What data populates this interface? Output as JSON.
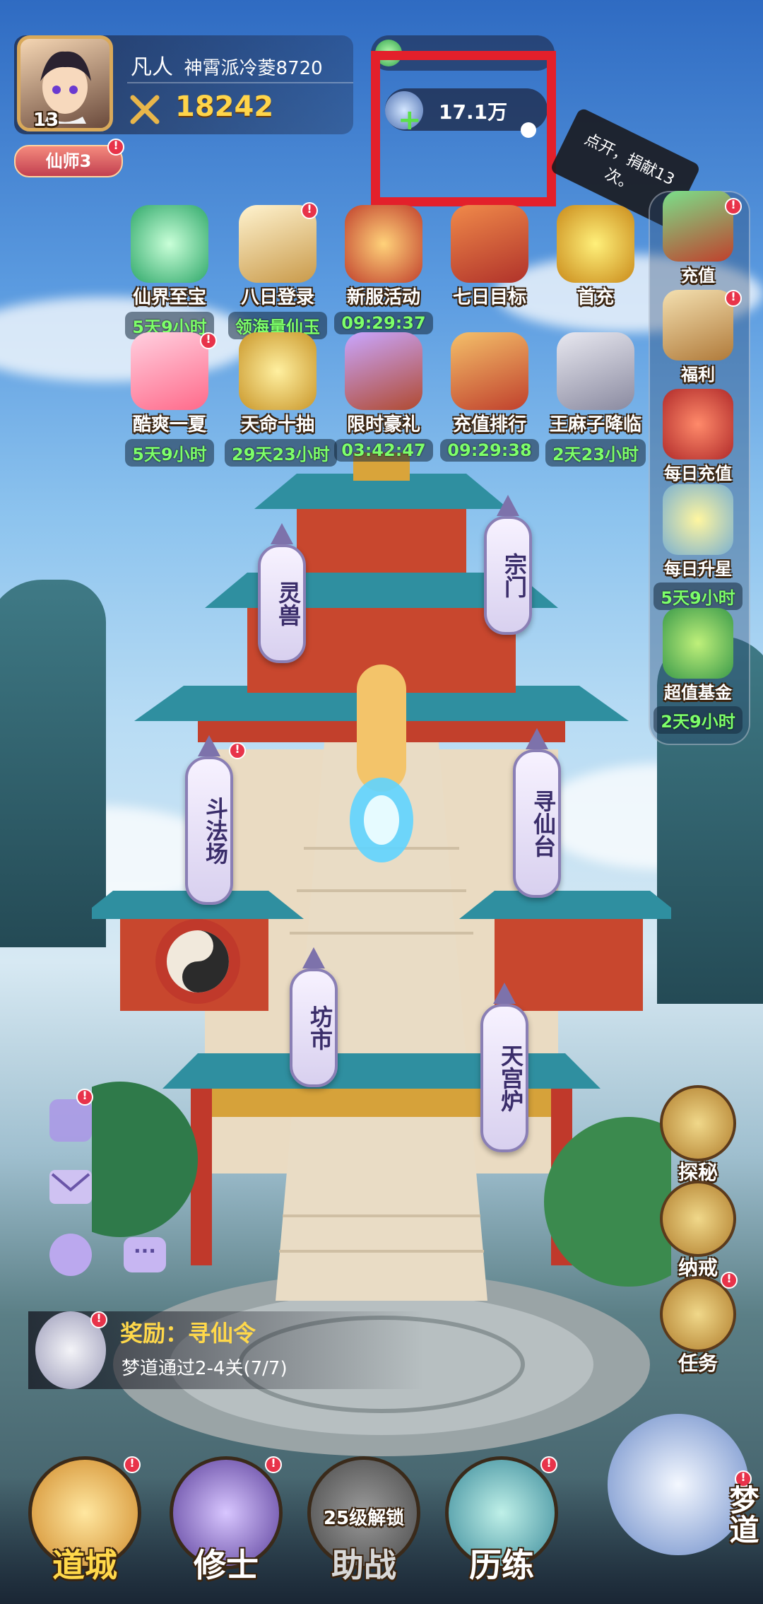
{
  "player": {
    "level": "13",
    "realm": "凡人",
    "name": "神霄派冷菱8720",
    "power": "18242",
    "title_badge": "仙师3"
  },
  "currency": {
    "top_value": "",
    "donate_value": "17.1万"
  },
  "tooltip": {
    "text": "点开，捐献13次。"
  },
  "events_row1": [
    {
      "label": "仙界至宝",
      "timer": "5天9小时",
      "icon": "jade-treasure-icon"
    },
    {
      "label": "八日登录",
      "timer": "领海量仙玉",
      "icon": "scroll-icon"
    },
    {
      "label": "新服活动",
      "timer": "09:29:37",
      "icon": "dragon-emblem-icon"
    },
    {
      "label": "七日目标",
      "timer": "",
      "icon": "chest-seven-icon"
    },
    {
      "label": "首充",
      "timer": "",
      "icon": "gold-coins-icon"
    }
  ],
  "events_row2": [
    {
      "label": "酷爽一夏",
      "timer": "5天9小时",
      "icon": "summer-drink-icon"
    },
    {
      "label": "天命十抽",
      "timer": "29天23小时",
      "icon": "fortune-bag-icon"
    },
    {
      "label": "限时豪礼",
      "timer": "03:42:47",
      "icon": "gift-box-icon"
    },
    {
      "label": "充值排行",
      "timer": "09:29:38",
      "icon": "ranking-gate-icon"
    },
    {
      "label": "王麻子降临",
      "timer": "2天23小时",
      "icon": "sage-portrait-icon"
    }
  ],
  "sidebar": [
    {
      "label": "充值",
      "timer": "",
      "icon": "recharge-chest-icon"
    },
    {
      "label": "福利",
      "timer": "",
      "icon": "welfare-box-icon"
    },
    {
      "label": "每日充值",
      "timer": "",
      "icon": "daily-bag-icon"
    },
    {
      "label": "每日升星",
      "timer": "5天9小时",
      "icon": "star-icon"
    },
    {
      "label": "超值基金",
      "timer": "2天9小时",
      "icon": "fund-icon"
    }
  ],
  "buildings": {
    "lingshou": "灵兽",
    "zongmen": "宗门",
    "doufachang": "斗法场",
    "xunxiantai": "寻仙台",
    "fangshi": "坊市",
    "tiangonglu": "天宫炉"
  },
  "right_buttons": [
    {
      "label": "探秘",
      "icon": "compass-icon"
    },
    {
      "label": "纳戒",
      "icon": "ring-icon"
    },
    {
      "label": "任务",
      "icon": "quest-scroll-icon"
    }
  ],
  "quest": {
    "reward": "奖励：寻仙令",
    "desc": "梦道通过2-4关(7/7)"
  },
  "bottom_nav": [
    {
      "label": "道城",
      "icon": "city-icon"
    },
    {
      "label": "修士",
      "icon": "cultivator-icon"
    },
    {
      "label": "助战",
      "icon": "assist-icon",
      "lock": "25级解锁"
    },
    {
      "label": "历练",
      "icon": "training-icon"
    },
    {
      "label": "梦道",
      "icon": "dream-path-icon"
    }
  ],
  "colors": {
    "highlight_box": "#e3202b",
    "timer_green": "#7dff6a",
    "badge_red": "#e8334a"
  }
}
